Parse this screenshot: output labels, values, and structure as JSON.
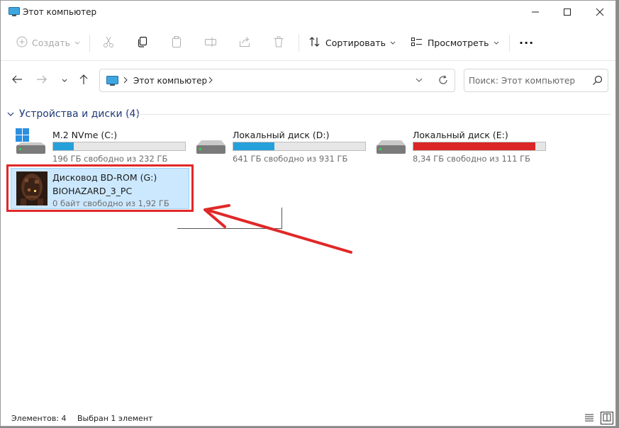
{
  "window": {
    "title": "Этот компьютер"
  },
  "toolbar": {
    "create_label": "Создать",
    "sort_label": "Сортировать",
    "view_label": "Просмотреть",
    "more_label": "···"
  },
  "address": {
    "crumb": "Этот компьютер",
    "search_placeholder": "Поиск: Этот компьютер"
  },
  "group": {
    "title": "Устройства и диски (4)"
  },
  "drives": [
    {
      "name": "M.2 NVme (C:)",
      "free_text": "196 ГБ свободно из 232 ГБ",
      "used_fraction": 0.155,
      "bar_color": "#26a0da",
      "icon": "windows-drive-icon"
    },
    {
      "name": "Локальный диск (D:)",
      "free_text": "641 ГБ свободно из 931 ГБ",
      "used_fraction": 0.311,
      "bar_color": "#26a0da",
      "icon": "hard-drive-icon"
    },
    {
      "name": "Локальный диск (E:)",
      "free_text": "8,34 ГБ свободно из 111 ГБ",
      "used_fraction": 0.925,
      "bar_color": "#da2626",
      "icon": "hard-drive-icon"
    },
    {
      "name": "Дисковод BD-ROM (G:)",
      "label": "BIOHAZARD_3_PC",
      "free_text": "0 байт свободно из 1,92 ГБ",
      "icon": "game-disc-cover-icon",
      "selected": true
    }
  ],
  "status": {
    "items": "Элементов: 4",
    "selected": "Выбран 1 элемент"
  },
  "colors": {
    "accent": "#0078d4",
    "selection_bg": "#cce8ff",
    "annotation_red": "#e02828"
  }
}
